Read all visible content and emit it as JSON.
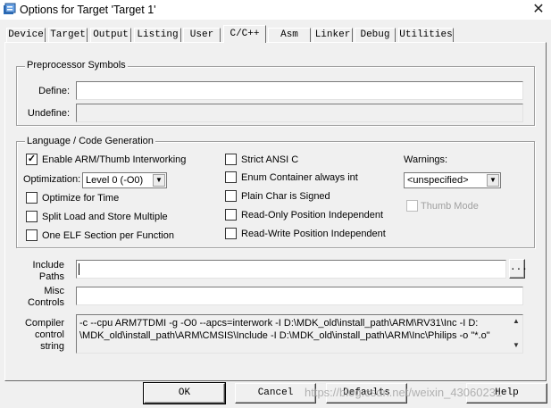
{
  "window": {
    "title": "Options for Target 'Target 1'",
    "close_glyph": "✕"
  },
  "tabs": [
    {
      "label": "Device"
    },
    {
      "label": "Target"
    },
    {
      "label": "Output"
    },
    {
      "label": "Listing"
    },
    {
      "label": "User"
    },
    {
      "label": "C/C++",
      "active": true
    },
    {
      "label": "Asm"
    },
    {
      "label": "Linker"
    },
    {
      "label": "Debug"
    },
    {
      "label": "Utilities"
    }
  ],
  "preprocessor": {
    "title": "Preprocessor Symbols",
    "define_label": "Define:",
    "define_value": "",
    "undefine_label": "Undefine:",
    "undefine_value": ""
  },
  "language": {
    "title": "Language / Code Generation",
    "enable_interworking": {
      "label": "Enable ARM/Thumb Interworking",
      "checked": true,
      "mark": "✓"
    },
    "optimization_label": "Optimization:",
    "optimization_value": "Level 0 (-O0)",
    "optimize_time": {
      "label": "Optimize for Time",
      "checked": false
    },
    "split_load": {
      "label": "Split Load and Store Multiple",
      "checked": false
    },
    "one_elf": {
      "label": "One ELF Section per Function",
      "checked": false
    },
    "strict_ansi": {
      "label": "Strict ANSI C",
      "checked": false
    },
    "enum_int": {
      "label": "Enum Container always int",
      "checked": false
    },
    "plain_char": {
      "label": "Plain Char is Signed",
      "checked": false
    },
    "ropi": {
      "label": "Read-Only Position Independent",
      "checked": false
    },
    "rwpi": {
      "label": "Read-Write Position Independent",
      "checked": false
    },
    "warnings_label": "Warnings:",
    "warnings_value": "<unspecified>",
    "thumb_mode": {
      "label": "Thumb Mode",
      "checked": false,
      "disabled": true
    }
  },
  "include_paths": {
    "label_line1": "Include",
    "label_line2": "Paths",
    "value": "",
    "browse_label": "..."
  },
  "misc_controls": {
    "label_line1": "Misc",
    "label_line2": "Controls",
    "value": ""
  },
  "compiler_control": {
    "label_line1": "Compiler",
    "label_line2": "control",
    "label_line3": "string",
    "line1": "-c --cpu ARM7TDMI -g -O0 --apcs=interwork -I D:\\MDK_old\\install_path\\ARM\\RV31\\Inc -I D:",
    "line2": "\\MDK_old\\install_path\\ARM\\CMSIS\\Include -I D:\\MDK_old\\install_path\\ARM\\Inc\\Philips -o \"*.o\""
  },
  "buttons": {
    "ok": "OK",
    "cancel": "Cancel",
    "defaults": "Defaults",
    "help": "Help"
  },
  "watermark": "https://blog.csdn.net/weixin_43060231",
  "colors": {
    "accent": "#2b6fbf",
    "dialog_bg": "#f0f0f0",
    "field_bg": "#ffffff"
  }
}
